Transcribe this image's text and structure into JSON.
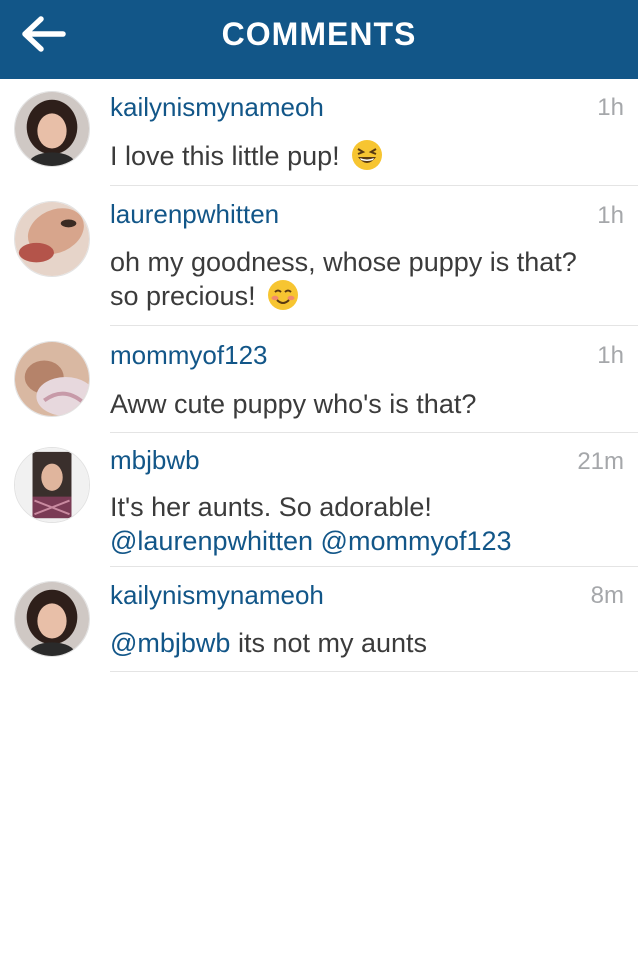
{
  "header": {
    "title": "COMMENTS",
    "back_icon": "arrow-left-icon"
  },
  "colors": {
    "header_bg": "#125688",
    "username": "#125688",
    "text": "#3b3b3b",
    "timestamp": "#a5a7aa"
  },
  "comments": [
    {
      "username": "kailynismynameoh",
      "time": "1h",
      "text": "I love this little pup!",
      "emoji": "grinning-squinting-face-icon"
    },
    {
      "username": "laurenpwhitten",
      "time": "1h",
      "line1": "oh my goodness, whose puppy is that?",
      "line2": "so precious!",
      "emoji": "smiling-face-icon"
    },
    {
      "username": "mommyof123",
      "time": "1h",
      "text": "Aww cute puppy who's is that?"
    },
    {
      "username": "mbjbwb",
      "time": "21m",
      "line1": "It's her aunts. So adorable!",
      "mention1": "@laurenpwhitten",
      "mention2": "@mommyof123"
    },
    {
      "username": "kailynismynameoh",
      "time": "8m",
      "mention": "@mbjbwb",
      "text": "its not my aunts"
    }
  ]
}
